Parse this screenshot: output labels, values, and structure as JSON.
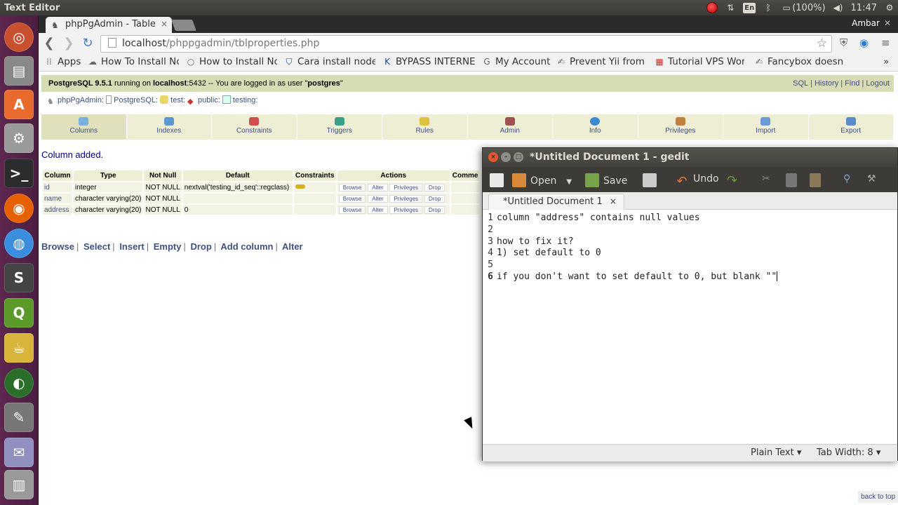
{
  "topbar": {
    "title": "Text Editor",
    "battery": "(100%)",
    "lang": "En",
    "time": "11:47"
  },
  "browser": {
    "tab_title": "phpPgAdmin - Table",
    "profile": "Ambar",
    "url_host": "localhost",
    "url_path": "/phppgadmin/tblproperties.php",
    "bookmarks": [
      {
        "label": "Apps",
        "icon": "apps-grid-icon"
      },
      {
        "label": "How To Install No",
        "icon": "cloud-icon"
      },
      {
        "label": "How to Install No",
        "icon": "circle-icon"
      },
      {
        "label": "Cara install node",
        "icon": "shield-icon"
      },
      {
        "label": "BYPASS INTERNE",
        "icon": "k-icon"
      },
      {
        "label": "My Account",
        "icon": "google-icon"
      },
      {
        "label": "Prevent Yii from",
        "icon": "script-icon"
      },
      {
        "label": "Tutorial VPS Wor",
        "icon": "grid-color-icon"
      },
      {
        "label": "Fancybox doesn'",
        "icon": "script-icon"
      }
    ],
    "more_bookmarks": "»"
  },
  "pga": {
    "server_version": "PostgreSQL 9.5.1",
    "running_on": " running on ",
    "host": "localhost",
    "port_text": ":5432 -- You are logged in as user \"",
    "user": "postgres",
    "user_end": "\"",
    "top_links": [
      "SQL",
      "History",
      "Find",
      "Logout"
    ],
    "breadcrumb": [
      "phpPgAdmin",
      "PostgreSQL",
      "test",
      "public",
      "testing"
    ],
    "tabs": [
      "Columns",
      "Indexes",
      "Constraints",
      "Triggers",
      "Rules",
      "Admin",
      "Info",
      "Privileges",
      "Import",
      "Export"
    ],
    "message": "Column added.",
    "table_headers": [
      "Column",
      "Type",
      "Not Null",
      "Default",
      "Constraints",
      "Actions",
      "Comme"
    ],
    "rows": [
      {
        "column": "id",
        "type": "integer",
        "not_null": "NOT NULL",
        "default": "nextval('testing_id_seq'::regclass)",
        "has_key": true
      },
      {
        "column": "name",
        "type": "character varying(20)",
        "not_null": "NOT NULL",
        "default": "",
        "has_key": false
      },
      {
        "column": "address",
        "type": "character varying(20)",
        "not_null": "NOT NULL",
        "default": "0",
        "has_key": false
      }
    ],
    "row_actions": [
      "Browse",
      "Alter",
      "Privileges",
      "Drop"
    ],
    "bottom_actions": [
      "Browse",
      "Select",
      "Insert",
      "Empty",
      "Drop",
      "Add column",
      "Alter"
    ],
    "back_to_top": "back to top"
  },
  "gedit": {
    "window_title": "*Untitled Document 1 - gedit",
    "toolbar": {
      "open": "Open",
      "save": "Save",
      "undo": "Undo"
    },
    "tab_label": "*Untitled Document 1",
    "tab_close": "×",
    "lines": [
      {
        "num": "1",
        "text": "column \"address\" contains null values"
      },
      {
        "num": "2",
        "text": ""
      },
      {
        "num": "3",
        "text": "how to fix it?"
      },
      {
        "num": "4",
        "text": "1) set default to 0"
      },
      {
        "num": "5",
        "text": ""
      },
      {
        "num": "6",
        "text": "if you don't want to set default to 0, but blank \"\""
      }
    ],
    "status": {
      "mode": "Plain Text ▾",
      "tab_width": "Tab Width: 8 ▾"
    }
  }
}
